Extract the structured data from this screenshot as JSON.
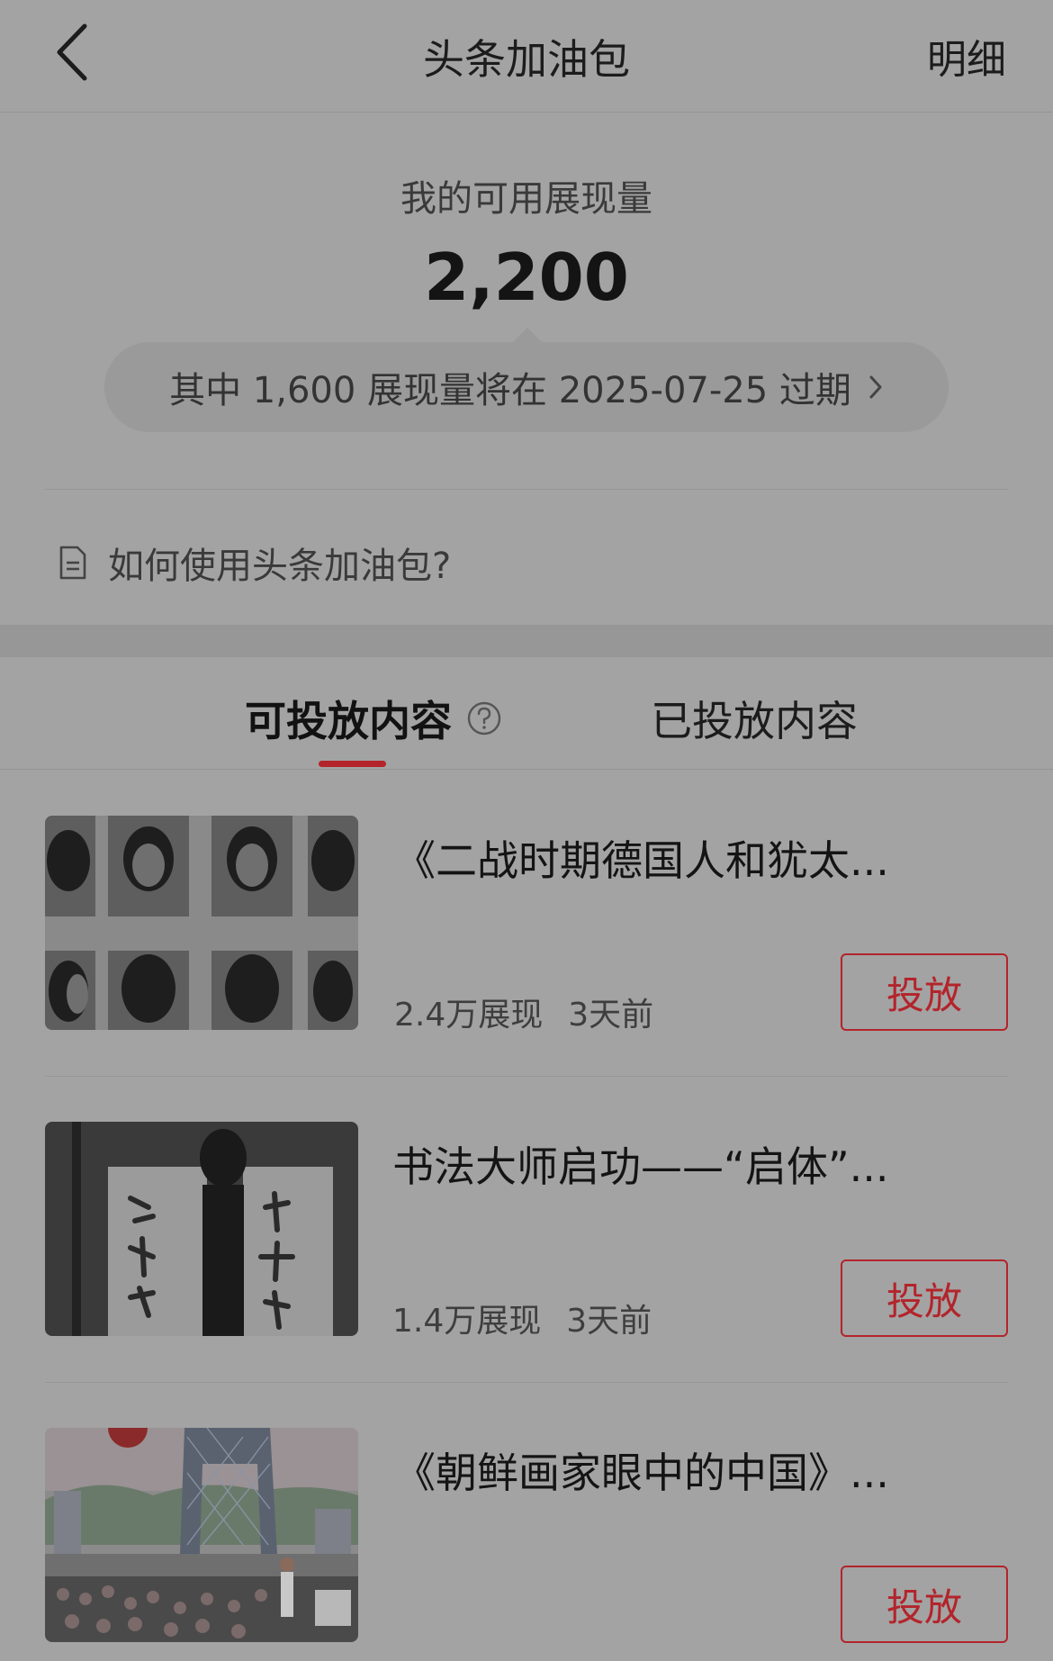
{
  "header": {
    "title": "头条加油包",
    "detail_label": "明细"
  },
  "summary": {
    "available_label": "我的可用展现量",
    "available_value": "2,200",
    "expire_notice": "其中 1,600 展现量将在 2025-07-25 过期",
    "howto_label": "如何使用头条加油包?"
  },
  "tabs": [
    {
      "label": "可投放内容",
      "active": true
    },
    {
      "label": "已投放内容",
      "active": false
    }
  ],
  "items": [
    {
      "title": "《二战时期德国人和犹太...",
      "views": "2.4万展现",
      "time": "3天前",
      "button": "投放",
      "thumb": "portrait-grid-photo"
    },
    {
      "title": "书法大师启功——“启体”...",
      "views": "1.4万展现",
      "time": "3天前",
      "button": "投放",
      "thumb": "calligraphy-photo"
    },
    {
      "title": "《朝鲜画家眼中的中国》...",
      "views": "",
      "time": "",
      "button": "投放",
      "thumb": "painting-cctv-building"
    }
  ],
  "colors": {
    "accent": "#b3242b",
    "background": "#a3a3a3"
  }
}
